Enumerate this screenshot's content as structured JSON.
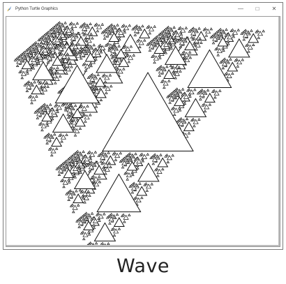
{
  "window": {
    "title": "Python Turtle Graphics",
    "controls": {
      "minimize": "—",
      "maximize": "□",
      "close": "✕"
    }
  },
  "caption": "Wave",
  "colors": {
    "stroke": "#111111",
    "fill": "#ffffff",
    "frame": "#9a9a9a"
  },
  "icons": {
    "app": "feather-icon",
    "minimize": "minimize-icon",
    "maximize": "maximize-icon",
    "close": "close-icon"
  }
}
